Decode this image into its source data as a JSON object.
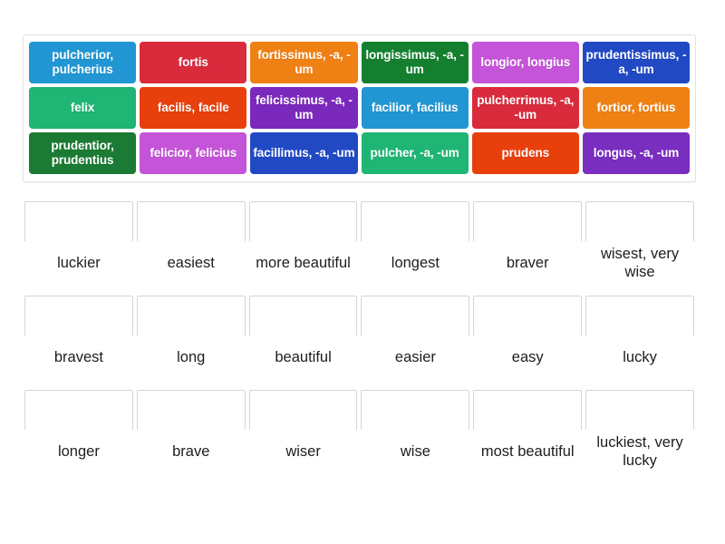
{
  "activity": {
    "type": "drag-and-drop-match",
    "tile_text_color": "#ffffff",
    "dropzone_border_color": "#d5d5d5",
    "tray_border_color": "#e2e2e2"
  },
  "tiles": {
    "rows": [
      [
        {
          "label": "pulcherior, pulcherius",
          "color": "#2196d3"
        },
        {
          "label": "fortis",
          "color": "#d92b3c"
        },
        {
          "label": "fortissimus, -a, -um",
          "color": "#ef8014"
        },
        {
          "label": "longissimus, -a, -um",
          "color": "#14802f"
        },
        {
          "label": "longior, longius",
          "color": "#c454d8"
        },
        {
          "label": "prudentissimus, -a, -um",
          "color": "#2149c4"
        }
      ],
      [
        {
          "label": "felix",
          "color": "#1fb574"
        },
        {
          "label": "facilis, facile",
          "color": "#e8400d"
        },
        {
          "label": "felicissimus, -a, -um",
          "color": "#7b28bd"
        },
        {
          "label": "facilior, facilius",
          "color": "#2196d3"
        },
        {
          "label": "pulcherrimus, -a, -um",
          "color": "#d92b3c"
        },
        {
          "label": "fortior, fortius",
          "color": "#ef8014"
        }
      ],
      [
        {
          "label": "prudentior, prudentius",
          "color": "#1b7a33"
        },
        {
          "label": "felicior, felicius",
          "color": "#c454d8"
        },
        {
          "label": "facillimus, -a, -um",
          "color": "#2149c4"
        },
        {
          "label": "pulcher, -a, -um",
          "color": "#1fb574"
        },
        {
          "label": "prudens",
          "color": "#e8400d"
        },
        {
          "label": "longus, -a, -um",
          "color": "#7a2ec0"
        }
      ]
    ]
  },
  "dropzones": {
    "rows": [
      [
        {
          "label": "luckier"
        },
        {
          "label": "easiest"
        },
        {
          "label": "more beautiful"
        },
        {
          "label": "longest"
        },
        {
          "label": "braver"
        },
        {
          "label": "wisest, very wise"
        }
      ],
      [
        {
          "label": "bravest"
        },
        {
          "label": "long"
        },
        {
          "label": "beautiful"
        },
        {
          "label": "easier"
        },
        {
          "label": "easy"
        },
        {
          "label": "lucky"
        }
      ],
      [
        {
          "label": "longer"
        },
        {
          "label": "brave"
        },
        {
          "label": "wiser"
        },
        {
          "label": "wise"
        },
        {
          "label": "most beautiful"
        },
        {
          "label": "luckiest, very lucky"
        }
      ]
    ]
  }
}
